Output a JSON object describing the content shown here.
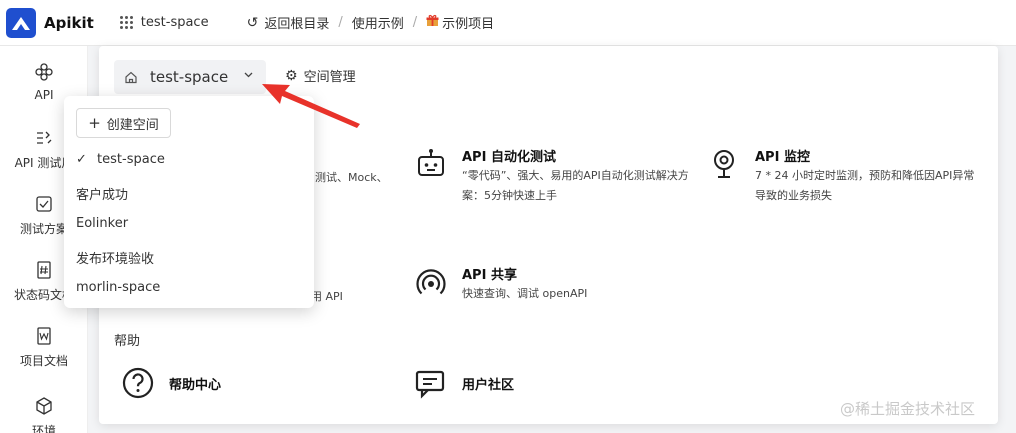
{
  "app": {
    "name": "Apikit"
  },
  "topbar": {
    "workspace": "test-space",
    "back_label": "返回根目录",
    "crumb1": "使用示例",
    "crumb2": "示例项目",
    "crumb2_icon": "gift-icon"
  },
  "sidebar": {
    "items": [
      {
        "label": "API",
        "icon": "api-icon"
      },
      {
        "label": "API 测试用",
        "icon": "test-case-icon"
      },
      {
        "label": "测试方案",
        "icon": "checkbox-icon"
      },
      {
        "label": "状态码文档",
        "icon": "hash-doc-icon"
      },
      {
        "label": "项目文档",
        "icon": "word-doc-icon"
      },
      {
        "label": "环境",
        "icon": "cube-icon"
      }
    ]
  },
  "panel": {
    "space_select": "test-space",
    "manage_label": "空间管理",
    "features": [
      {
        "title": "API 自动化测试",
        "desc": "“零代码”、强大、易用的API自动化测试解决方案：5分钟快速上手",
        "icon": "robot-icon"
      },
      {
        "title": "API 监控",
        "desc": "7 * 24 小时定时监测，预防和降低因API异常导致的业务损失",
        "icon": "webcam-icon"
      },
      {
        "title": "API 共享",
        "desc": "快速查询、调试 openAPI",
        "icon": "broadcast-icon"
      }
    ],
    "frag1": "测试、Mock、",
    "frag2": "使用 API",
    "help_label": "帮助",
    "help_items": [
      {
        "label": "帮助中心",
        "icon": "question-icon"
      },
      {
        "label": "用户社区",
        "icon": "chat-icon"
      }
    ]
  },
  "dropdown": {
    "create_label": "创建空间",
    "items": [
      "test-space",
      "客户成功",
      "Eolinker",
      "发布环境验收",
      "morlin-space"
    ],
    "selected": "test-space"
  },
  "watermark": "@稀土掘金技术社区",
  "colors": {
    "brand": "#1f4fcf",
    "annotation": "#e8322a"
  }
}
